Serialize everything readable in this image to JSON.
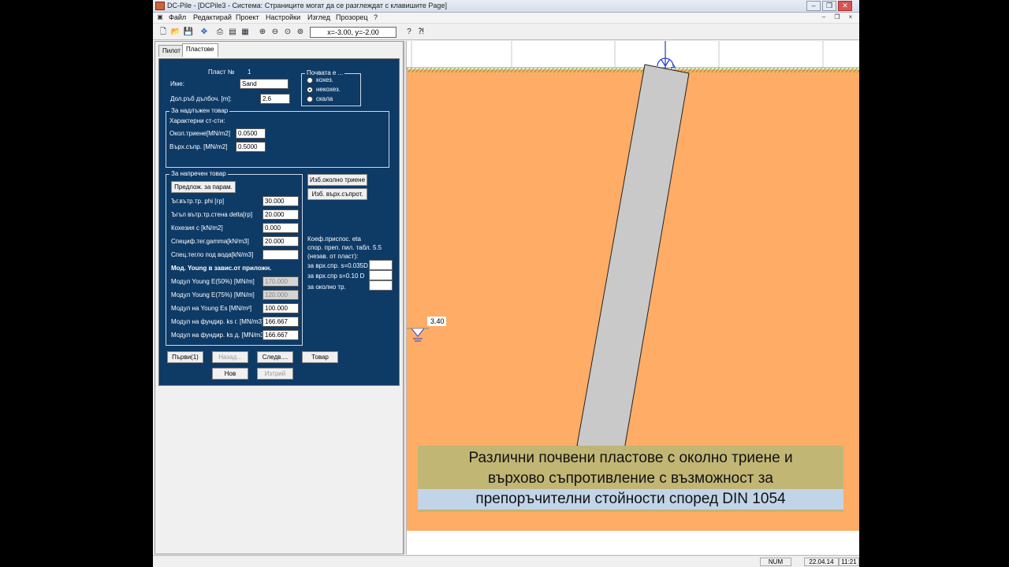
{
  "window": {
    "title": "DC-Pile - [DCPile3 - Система: Страниците могат да се разглеждат с клавишите Page]",
    "minimize": "–",
    "restore": "❒",
    "close": "✕"
  },
  "menu": [
    "Файл",
    "Редактирай",
    "Проект",
    "Настройки",
    "Изглед",
    "Прозорец",
    "?"
  ],
  "toolbar": {
    "coord": "x=-3.00, y=-2.00",
    "icons": [
      "new-icon",
      "open-icon",
      "save-icon",
      "view-icon",
      "print-icon",
      "print-preview-icon",
      "export-icon",
      "zoom-in-icon",
      "zoom-out-icon",
      "zoom-window-icon",
      "zoom-all-icon",
      "help-icon",
      "context-help-icon"
    ]
  },
  "tabs": [
    "Пилот",
    "Пластове"
  ],
  "layer": {
    "number_label": "Пласт №",
    "number_value": "1",
    "name_label": "Име:",
    "name_value": "Sand",
    "depth_label": "Дол.ръб дълбоч. [m]:",
    "depth_value": "2.6"
  },
  "soil_type": {
    "title": "Почвата е ...",
    "options": [
      "кохез.",
      "некохез.",
      "скала"
    ],
    "selected": 1
  },
  "compression": {
    "title": "За надлъжен товар",
    "char_label": "Характерни ст-сти:",
    "friction_label": "Окол.триене[MN/m2]",
    "friction_value": "0.0500",
    "tip_label": "Върх.съпр. [MN/m2]",
    "tip_value": "0.5000"
  },
  "transverse": {
    "title": "За напречен товар",
    "suggest_button": "Предлож. за парам.",
    "rows": [
      {
        "label": "Ъг.вътр.тр. phi [гр]",
        "value": "30.000",
        "disabled": false
      },
      {
        "label": "Ъгъл вътр.тр.стена delta[гр]",
        "value": "20.000",
        "disabled": false
      },
      {
        "label": "Кохезия c [kN/m2]",
        "value": "0.000",
        "disabled": false
      },
      {
        "label": "Специф.тег.gamma[kN/m3]",
        "value": "20.000",
        "disabled": false
      },
      {
        "label": "Спец.тегло под вода[kN/m3]",
        "value": "",
        "disabled": false
      },
      {
        "label": "Мод. Young в завис.от приложн.",
        "value": null,
        "disabled": false
      },
      {
        "label": "Модул Young E(50%) [MN/m]",
        "value": "170.000",
        "disabled": true
      },
      {
        "label": "Модул Young E(75%) [MN/m]",
        "value": "120.000",
        "disabled": true
      },
      {
        "label": "Модул на Young Es [MN/m²]",
        "value": "100.000",
        "disabled": false
      },
      {
        "label": "Модул на фундир. ks г. [MN/m3]",
        "value": "166.667",
        "disabled": false
      },
      {
        "label": "Модул на фундир. ks д. [MN/m3]",
        "value": "166.667",
        "disabled": false
      }
    ]
  },
  "right_buttons": [
    "Изб.околно триене",
    "Изб. върх.съпрот."
  ],
  "eta": {
    "lines": [
      "Коеф.приспос. eta",
      "спор. преп. пил. табл. 5.5",
      "(незав. от пласт):"
    ],
    "rows": [
      "за врх.спр. s=0.035D",
      "за врх.спр s=0.10 D",
      "за околно тр."
    ]
  },
  "nav": {
    "first": "Първи(1)",
    "back": "Назад...",
    "next": "Следв....",
    "load": "Товар",
    "new": "Нов",
    "delete": "Изтрий"
  },
  "drawing": {
    "water_level": "3.40",
    "colors": {
      "soil": "#ffac66",
      "pile": "#c9c9c9",
      "ground": "#8db04b",
      "axis": "#1f3bd6"
    }
  },
  "subtitle": {
    "line1": "Различни почвени пластове с околно триене и",
    "line2": "върхово съпротивление с възможност за",
    "line3": "препоръчителни стойности според DIN 1054"
  },
  "status": {
    "num": "NUM",
    "date": "22.04.14",
    "time": "11:21"
  }
}
